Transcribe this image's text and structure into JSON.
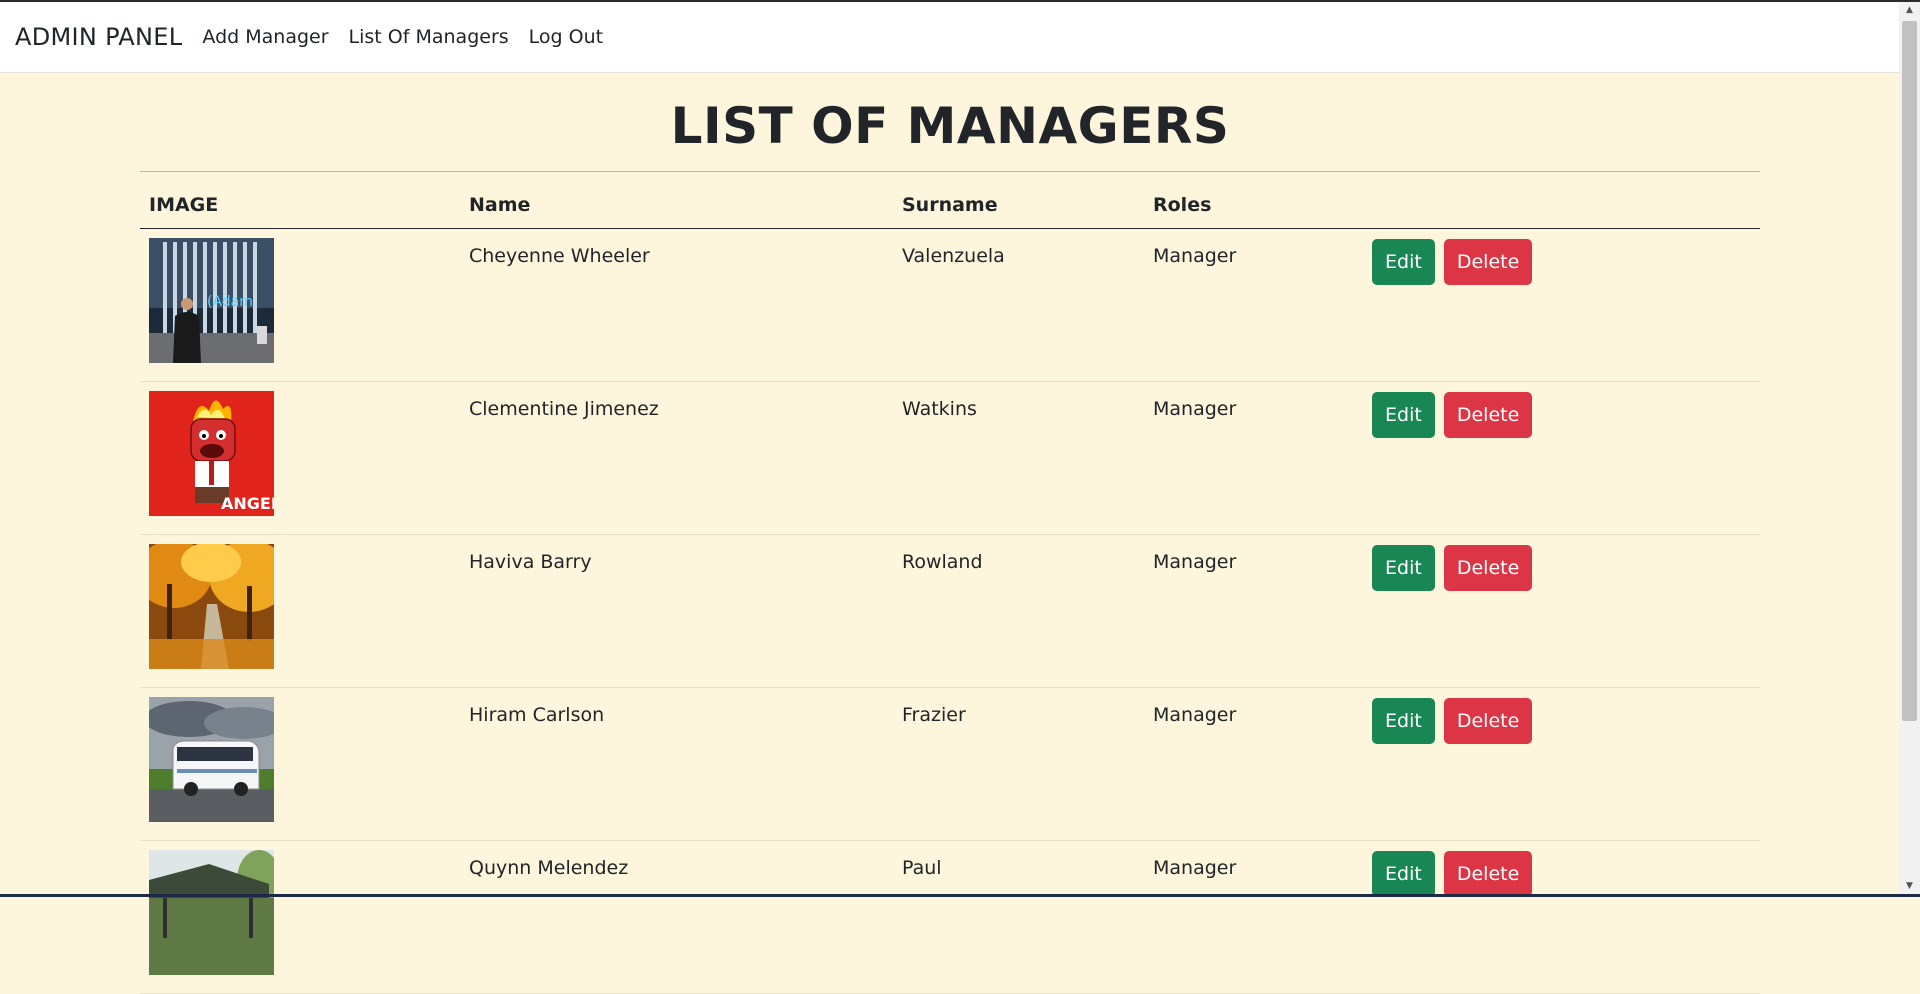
{
  "navbar": {
    "brand": "ADMIN PANEL",
    "links": [
      "Add Manager",
      "List Of Managers",
      "Log Out"
    ]
  },
  "page": {
    "title": "LIST OF MANAGERS"
  },
  "table": {
    "headers": [
      "IMAGE",
      "Name",
      "Surname",
      "Roles",
      ""
    ],
    "rows": [
      {
        "name": "Cheyenne Wheeler",
        "surname": "Valenzuela",
        "role": "Manager",
        "image": "office-photo"
      },
      {
        "name": "Clementine Jimenez",
        "surname": "Watkins",
        "role": "Manager",
        "image": "anger-character"
      },
      {
        "name": "Haviva Barry",
        "surname": "Rowland",
        "role": "Manager",
        "image": "autumn-path"
      },
      {
        "name": "Hiram Carlson",
        "surname": "Frazier",
        "role": "Manager",
        "image": "white-bus"
      },
      {
        "name": "Quynn Melendez",
        "surname": "Paul",
        "role": "Manager",
        "image": "garden-gazebo"
      }
    ],
    "edit_label": "Edit",
    "delete_label": "Delete"
  },
  "image_text": {
    "anger": "ANGER",
    "office": "(Adam"
  },
  "colors": {
    "background": "#fef6dc",
    "edit": "#198754",
    "delete": "#dc3545"
  }
}
